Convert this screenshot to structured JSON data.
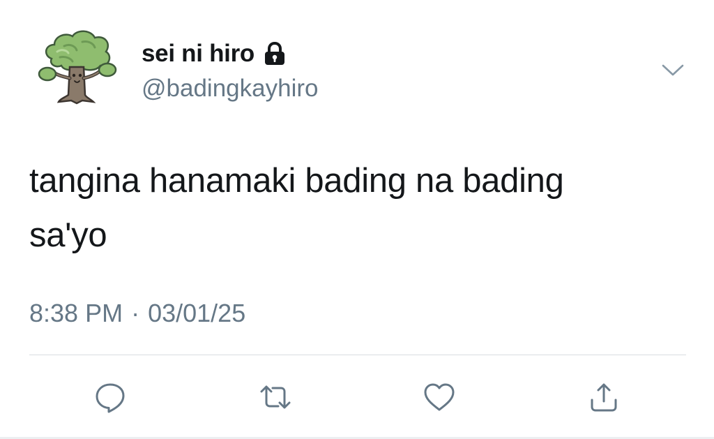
{
  "user": {
    "display_name": "sei ni hiro",
    "handle": "@badingkayhiro",
    "avatar_icon": "tree-character-icon",
    "protected_icon": "lock-icon"
  },
  "tweet": {
    "text_lines": [
      "tangina hanamaki bading na bading",
      "sa'yo"
    ],
    "time": "8:38 PM",
    "separator": "·",
    "date": "03/01/25"
  },
  "actions": {
    "reply_icon": "reply-icon",
    "retweet_icon": "retweet-icon",
    "like_icon": "heart-icon",
    "share_icon": "share-icon",
    "menu_icon": "chevron-down-icon"
  },
  "colors": {
    "text": "#14171a",
    "secondary": "#657786",
    "divider": "#d8dde1"
  }
}
